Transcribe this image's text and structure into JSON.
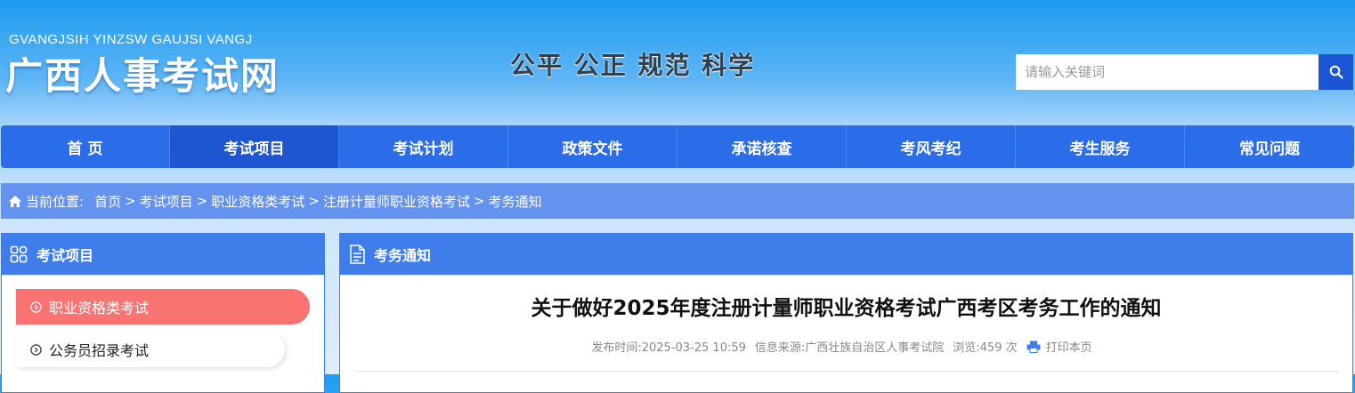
{
  "header": {
    "logo_en": "GVANGJSIH YINZSW GAUJSI VANGJ",
    "logo_cn": "广西人事考试网",
    "slogan": "公平 公正 规范 科学",
    "search_placeholder": "请输入关键词",
    "search_icon": "search-icon"
  },
  "nav": {
    "items": [
      "首 页",
      "考试项目",
      "考试计划",
      "政策文件",
      "承诺核查",
      "考风考纪",
      "考生服务",
      "常见问题"
    ],
    "active_index": 1
  },
  "breadcrumb": {
    "label": "当前位置:",
    "items": [
      "首页",
      "考试项目",
      "职业资格类考试",
      "注册计量师职业资格考试",
      "考务通知"
    ],
    "separator": ">"
  },
  "sidebar": {
    "title": "考试项目",
    "items": [
      {
        "label": "职业资格类考试",
        "active": true
      },
      {
        "label": "公务员招录考试",
        "active": false
      }
    ]
  },
  "main": {
    "panel_title": "考务通知",
    "article_title": "关于做好2025年度注册计量师职业资格考试广西考区考务工作的通知",
    "meta": {
      "publish_time": "发布时间:2025-03-25 10:59",
      "source": "信息来源:广西壮族自治区人事考试院",
      "views": "浏览:459 次",
      "print": "打印本页"
    }
  },
  "colors": {
    "nav_bg": "#2b6de8",
    "nav_active": "#1e55d0",
    "breadcrumb_bg": "#6492ef",
    "panel_head": "#3f7eea",
    "side_active": "#f97372",
    "search_btn": "#1c54d6"
  }
}
